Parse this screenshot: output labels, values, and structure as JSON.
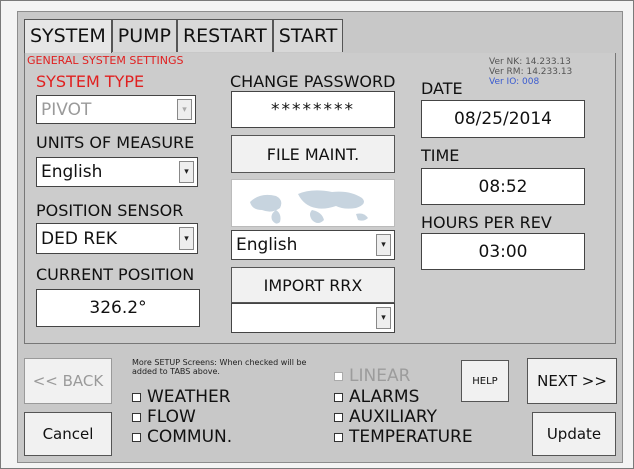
{
  "tabs": [
    "SYSTEM",
    "PUMP",
    "RESTART",
    "START"
  ],
  "section_title": "GENERAL SYSTEM SETTINGS",
  "version": {
    "nk": "Ver NK: 14.233.13",
    "rm": "Ver RM: 14.233.13",
    "io": "Ver IO: 008"
  },
  "system_type": {
    "label": "SYSTEM TYPE",
    "value": "PIVOT"
  },
  "units": {
    "label": "UNITS OF MEASURE",
    "value": "English"
  },
  "position_sensor": {
    "label": "POSITION SENSOR",
    "value": "DED REK"
  },
  "current_position": {
    "label": "CURRENT POSITION",
    "value": "326.2°"
  },
  "change_password": {
    "label": "CHANGE PASSWORD",
    "value": "********"
  },
  "file_maint_label": "FILE MAINT.",
  "language": {
    "value": "English"
  },
  "import_rrx_label": "IMPORT RRX",
  "import_select": {
    "value": ""
  },
  "date": {
    "label": "DATE",
    "value": "08/25/2014"
  },
  "time": {
    "label": "TIME",
    "value": "08:52"
  },
  "hours_per_rev": {
    "label": "HOURS PER REV",
    "value": "03:00"
  },
  "bottom": {
    "back_label": "<< BACK",
    "cancel_label": "Cancel",
    "note": "More SETUP Screens: When checked will be added to TABS above.",
    "checks_left": [
      "WEATHER",
      "FLOW",
      "COMMUN."
    ],
    "checks_right": [
      "LINEAR",
      "ALARMS",
      "AUXILIARY",
      "TEMPERATURE"
    ],
    "help_label": "HELP",
    "next_label": "NEXT >>",
    "update_label": "Update"
  }
}
